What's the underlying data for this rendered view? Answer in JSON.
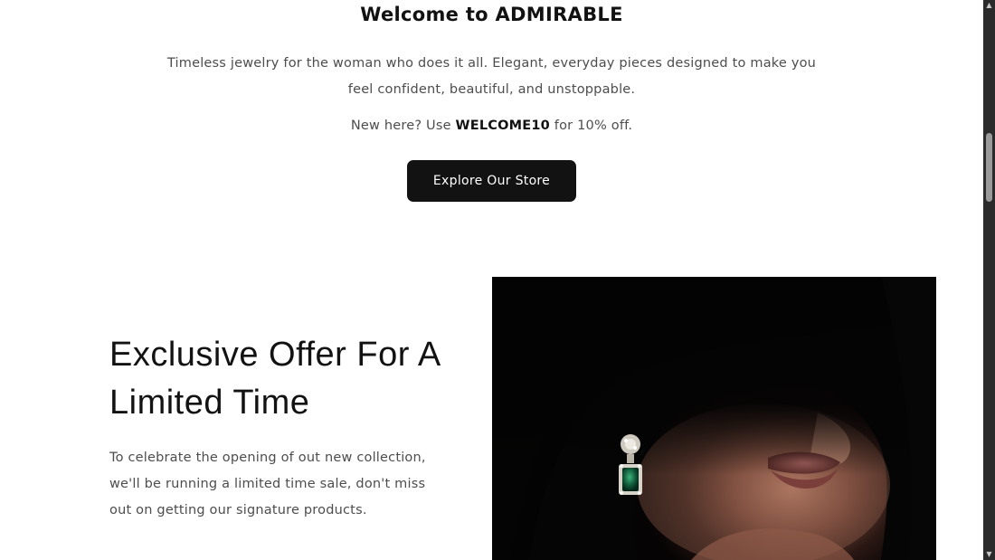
{
  "welcome": {
    "title": "Welcome to ADMIRABLE",
    "description": "Timeless jewelry for the woman who does it all. Elegant, everyday pieces designed to make you feel confident, beautiful, and unstoppable.",
    "promo_prefix": "New here? Use ",
    "promo_code": "WELCOME10",
    "promo_suffix": " for 10% off.",
    "cta_label": "Explore Our Store"
  },
  "offer": {
    "title": "Exclusive Offer For A Limited Time",
    "description": "To celebrate the opening of out new collection, we'll be running a limited time sale, don't miss out on getting our signature products."
  },
  "colors": {
    "primary": "#121212",
    "text_muted": "#4d4d4d",
    "background": "#ffffff",
    "emerald": "#0f5a3a"
  },
  "icons": {
    "scroll_up": "triangle-up",
    "scroll_down": "triangle-down"
  }
}
